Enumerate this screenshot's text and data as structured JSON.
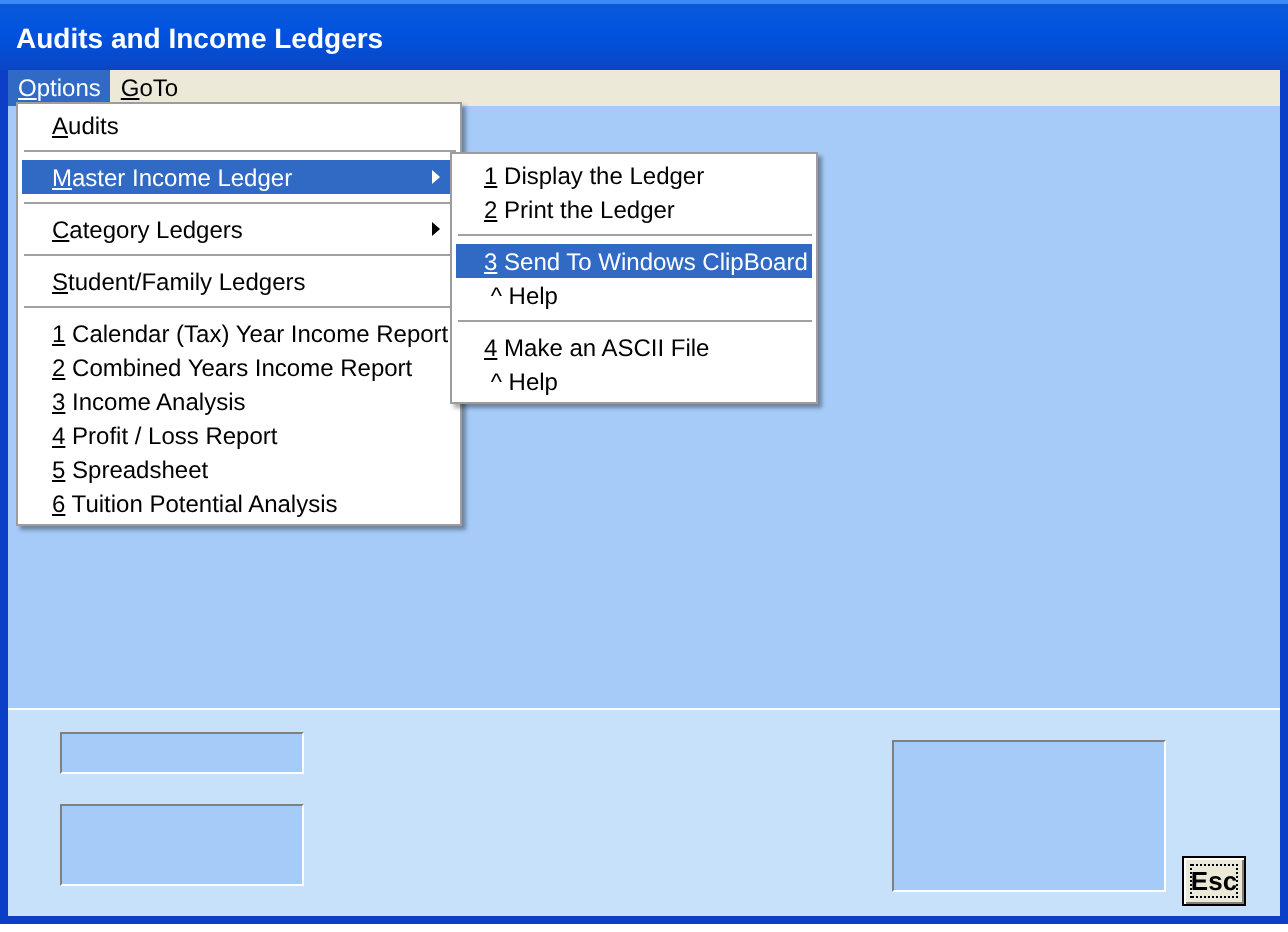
{
  "window": {
    "title": "Audits and Income Ledgers"
  },
  "menu_bar": [
    {
      "label": "Options",
      "mnemonic": true,
      "selected": true
    },
    {
      "label": "GoTo",
      "mnemonic": true,
      "selected": false
    }
  ],
  "options_menu": [
    {
      "kind": "item",
      "label": "Audits",
      "mnemonic": true,
      "submenu": false,
      "selected": false
    },
    {
      "kind": "separator"
    },
    {
      "kind": "item",
      "label": "Master Income Ledger",
      "mnemonic": true,
      "submenu": true,
      "selected": true
    },
    {
      "kind": "separator"
    },
    {
      "kind": "item",
      "label": "Category Ledgers",
      "mnemonic": true,
      "submenu": true,
      "selected": false
    },
    {
      "kind": "separator"
    },
    {
      "kind": "item",
      "label": "Student/Family Ledgers",
      "mnemonic": true,
      "submenu": false,
      "selected": false
    },
    {
      "kind": "separator"
    },
    {
      "kind": "item",
      "label": "1 Calendar (Tax) Year Income Report",
      "mnemonic": true,
      "submenu": false,
      "selected": false
    },
    {
      "kind": "item",
      "label": "2 Combined Years Income Report",
      "mnemonic": true,
      "submenu": false,
      "selected": false
    },
    {
      "kind": "item",
      "label": "3 Income Analysis",
      "mnemonic": true,
      "submenu": false,
      "selected": false
    },
    {
      "kind": "item",
      "label": "4 Profit / Loss Report",
      "mnemonic": true,
      "submenu": false,
      "selected": false
    },
    {
      "kind": "item",
      "label": "5 Spreadsheet",
      "mnemonic": true,
      "submenu": false,
      "selected": false
    },
    {
      "kind": "item",
      "label": "6 Tuition Potential Analysis",
      "mnemonic": true,
      "submenu": false,
      "selected": false
    }
  ],
  "ledger_submenu": [
    {
      "kind": "item",
      "label": "1 Display the Ledger",
      "mnemonic": true,
      "submenu": false,
      "selected": false
    },
    {
      "kind": "item",
      "label": "2 Print the Ledger",
      "mnemonic": true,
      "submenu": false,
      "selected": false
    },
    {
      "kind": "separator"
    },
    {
      "kind": "item",
      "label": "3 Send To Windows ClipBoard",
      "mnemonic": true,
      "submenu": false,
      "selected": true
    },
    {
      "kind": "item",
      "label": " ^ Help",
      "mnemonic": false,
      "submenu": false,
      "selected": false
    },
    {
      "kind": "separator"
    },
    {
      "kind": "item",
      "label": "4 Make an ASCII File",
      "mnemonic": true,
      "submenu": false,
      "selected": false
    },
    {
      "kind": "item",
      "label": " ^ Help",
      "mnemonic": false,
      "submenu": false,
      "selected": false
    }
  ],
  "esc_button": {
    "label": "Esc"
  }
}
